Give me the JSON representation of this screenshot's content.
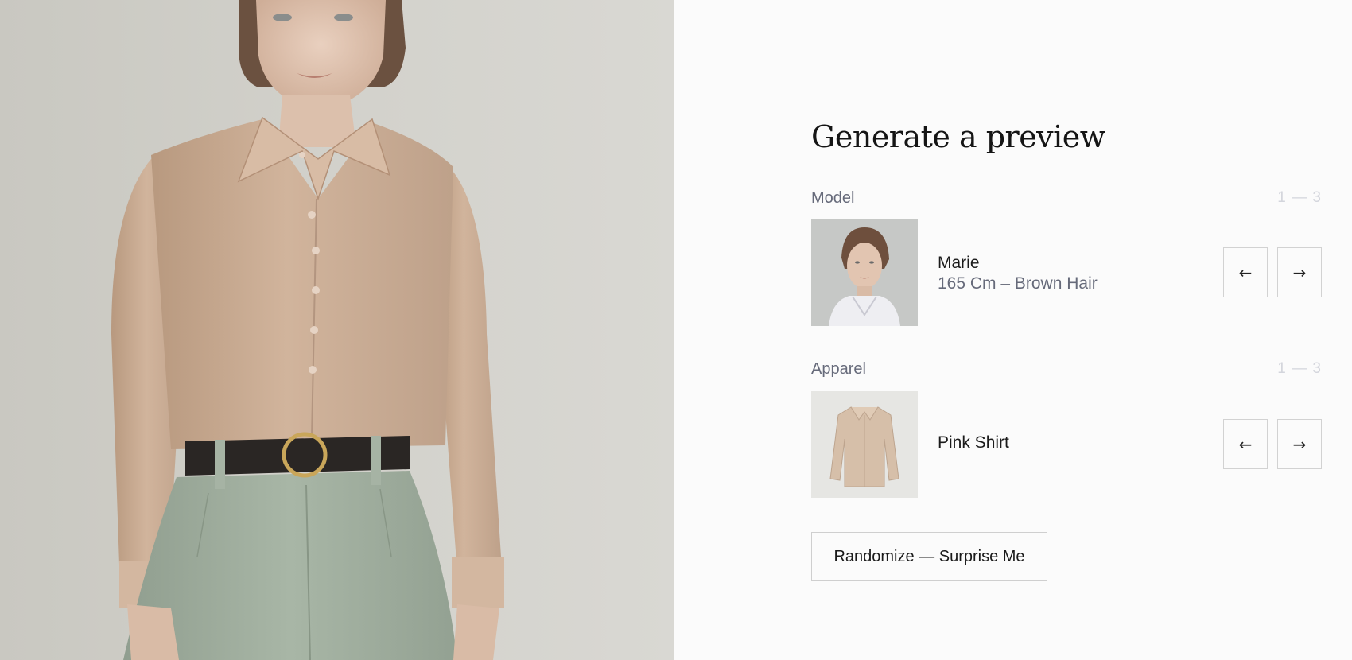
{
  "title": "Generate a preview",
  "model": {
    "label": "Model",
    "count": "1 — 3",
    "name": "Marie",
    "details": "165 Cm – Brown Hair",
    "prev": "←",
    "next": "→"
  },
  "apparel": {
    "label": "Apparel",
    "count": "1 — 3",
    "name": "Pink Shirt",
    "prev": "←",
    "next": "→"
  },
  "randomize_label": "Randomize — Surprise Me",
  "colors": {
    "shirt": "#c8aa92",
    "trousers": "#9fae9e",
    "background": "#fbfbfb",
    "muted_text": "#666a7a"
  }
}
